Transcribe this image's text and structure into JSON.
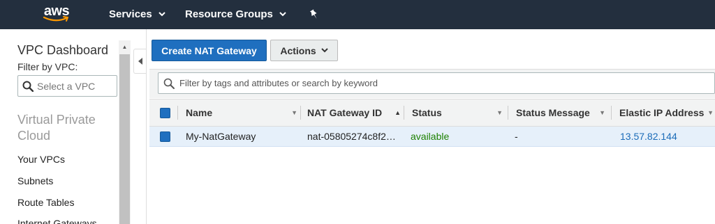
{
  "topnav": {
    "logo_text": "aws",
    "services_label": "Services",
    "resource_groups_label": "Resource Groups",
    "chevron": "⌄",
    "pin_icon": "pushpin-icon",
    "background": "#232f3e"
  },
  "sidebar": {
    "title": "VPC Dashboard",
    "filter_label": "Filter by VPC:",
    "vpc_select_placeholder": "Select a VPC",
    "section_title": "Virtual Private Cloud",
    "links": [
      "Your VPCs",
      "Subnets",
      "Route Tables",
      "Internet Gateways"
    ]
  },
  "toolbar": {
    "create_label": "Create NAT Gateway",
    "actions_label": "Actions",
    "primary_color": "#1f6fbf"
  },
  "search": {
    "placeholder": "Filter by tags and attributes or search by keyword"
  },
  "table": {
    "columns": [
      "Name",
      "NAT Gateway ID",
      "Status",
      "Status Message",
      "Elastic IP Address"
    ],
    "rows": [
      {
        "name": "My-NatGateway",
        "nat_gateway_id": "nat-05805274c8f2…",
        "status": "available",
        "status_message": "-",
        "elastic_ip": "13.57.82.144"
      }
    ],
    "status_color": "#1d8102",
    "link_color": "#1a6bb8"
  }
}
